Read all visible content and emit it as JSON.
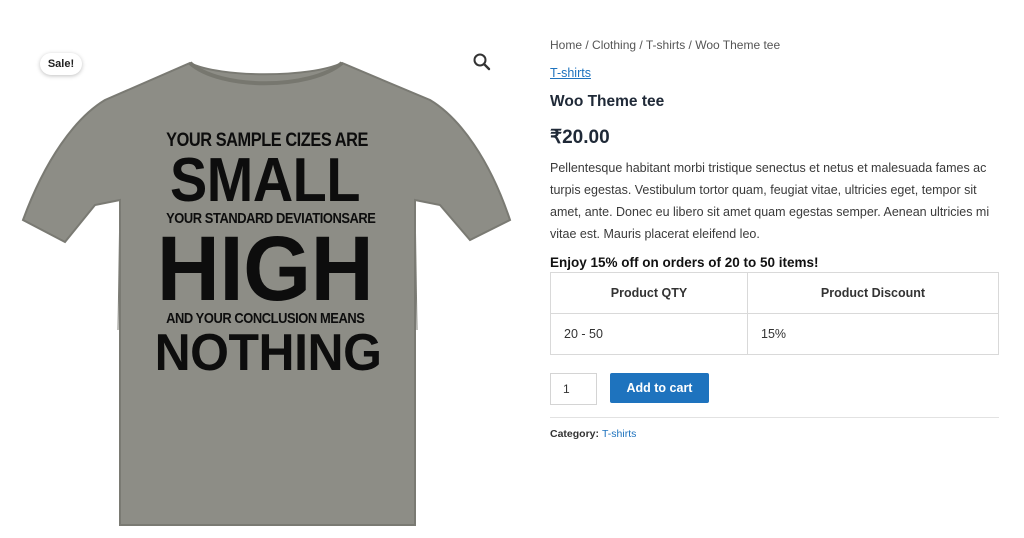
{
  "product_image": {
    "sale_badge": "Sale!",
    "zoom_icon": "search-icon",
    "shirt_color": "#8c8c85",
    "print_lines": [
      "YOUR SAMPLE CIZES ARE",
      "SMALL",
      "YOUR STANDARD DEVIATIONSARE",
      "HIGH",
      "AND YOUR CONCLUSION MEANS",
      "NOTHING"
    ]
  },
  "breadcrumb": {
    "items": [
      "Home",
      "Clothing",
      "T-shirts"
    ],
    "separator": " / ",
    "current": "Woo Theme tee"
  },
  "category_link": "T-shirts",
  "product": {
    "title": "Woo Theme tee",
    "price": "₹20.00",
    "description": "Pellentesque habitant morbi tristique senectus et netus et malesuada fames ac turpis egestas. Vestibulum tortor quam, feugiat vitae, ultricies eget, tempor sit amet, ante. Donec eu libero sit amet quam egestas semper. Aenean ultricies mi vitae est. Mauris placerat eleifend leo."
  },
  "discount": {
    "heading": "Enjoy 15% off on orders of 20 to 50 items!",
    "columns": [
      "Product QTY",
      "Product Discount"
    ],
    "rows": [
      [
        "20 - 50",
        "15%"
      ]
    ]
  },
  "cart": {
    "quantity": "1",
    "add_label": "Add to cart"
  },
  "meta": {
    "category_label": "Category:",
    "category_value": "T-shirts"
  },
  "colors": {
    "accent": "#1e73be",
    "text": "#3a3a3a",
    "heading": "#1f2937"
  }
}
